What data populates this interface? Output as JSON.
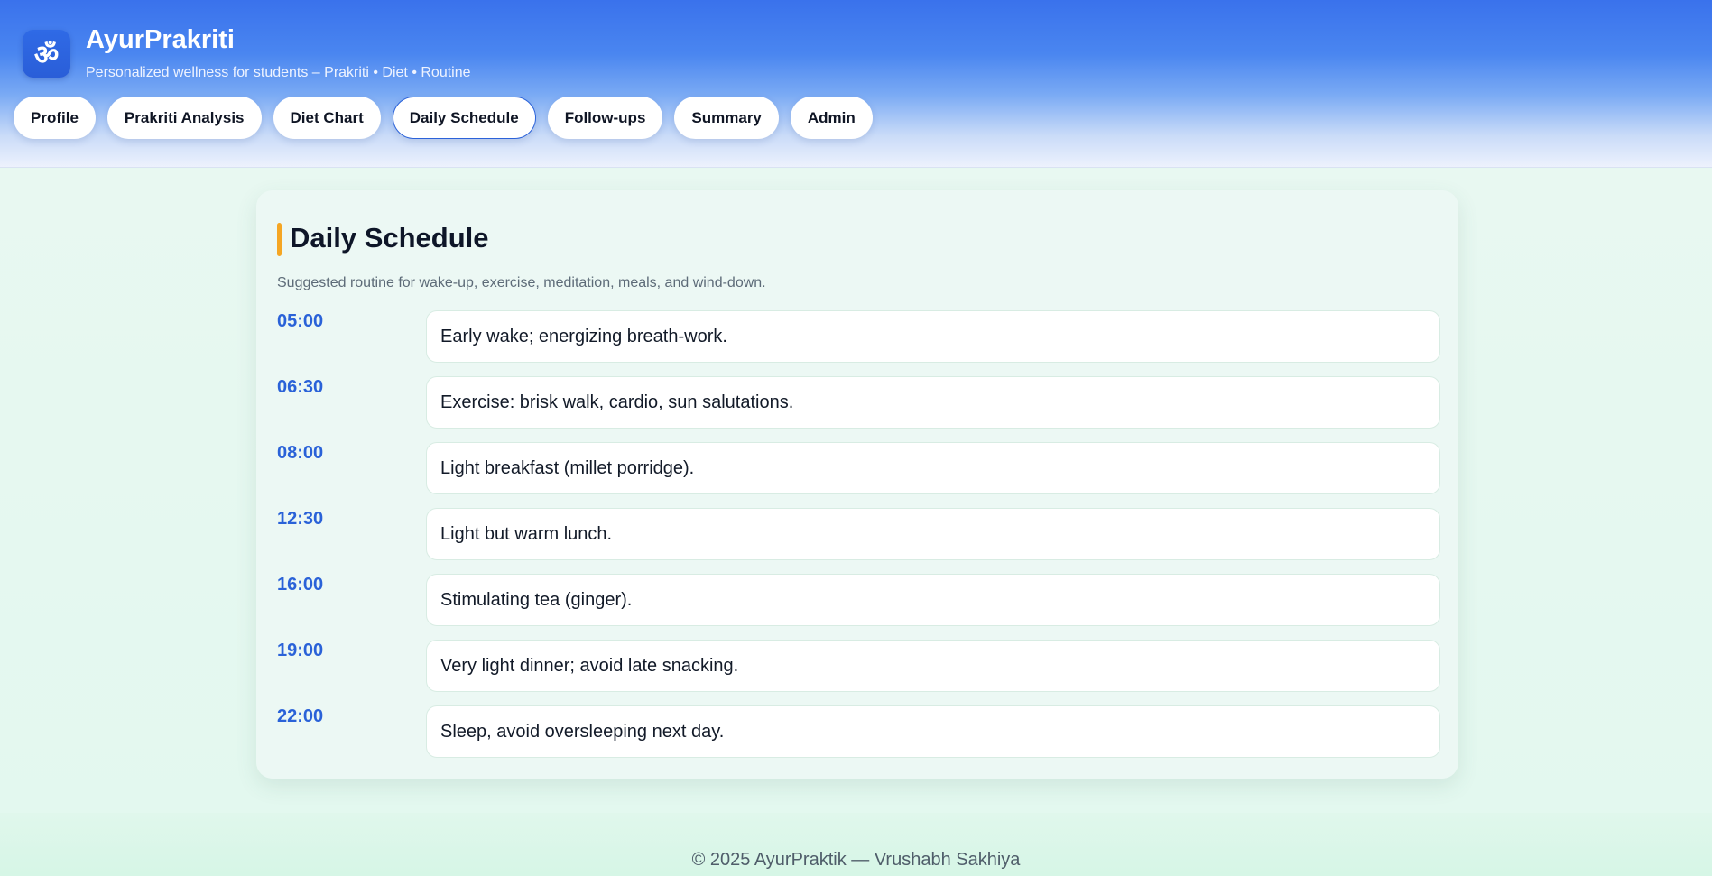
{
  "header": {
    "logo_glyph": "ॐ",
    "title": "AyurPrakriti",
    "subtitle": "Personalized wellness for students – Prakriti • Diet • Routine"
  },
  "nav": {
    "tabs": [
      {
        "label": "Profile",
        "active": false
      },
      {
        "label": "Prakriti Analysis",
        "active": false
      },
      {
        "label": "Diet Chart",
        "active": false
      },
      {
        "label": "Daily Schedule",
        "active": true
      },
      {
        "label": "Follow-ups",
        "active": false
      },
      {
        "label": "Summary",
        "active": false
      },
      {
        "label": "Admin",
        "active": false
      }
    ]
  },
  "schedule": {
    "title": "Daily Schedule",
    "subtitle": "Suggested routine for wake-up, exercise, meditation, meals, and wind-down.",
    "items": [
      {
        "time": "05:00",
        "activity": "Early wake; energizing breath-work."
      },
      {
        "time": "06:30",
        "activity": "Exercise: brisk walk, cardio, sun salutations."
      },
      {
        "time": "08:00",
        "activity": "Light breakfast (millet porridge)."
      },
      {
        "time": "12:30",
        "activity": "Light but warm lunch."
      },
      {
        "time": "16:00",
        "activity": "Stimulating tea (ginger)."
      },
      {
        "time": "19:00",
        "activity": "Very light dinner; avoid late snacking."
      },
      {
        "time": "22:00",
        "activity": "Sleep, avoid oversleeping next day."
      }
    ]
  },
  "footer": {
    "text": "© 2025 AyurPraktik — Vrushabh Sakhiya"
  },
  "colors": {
    "accent": "#2a62d8",
    "title_bar": "#f5a623",
    "header_top": "#3a72ec"
  }
}
